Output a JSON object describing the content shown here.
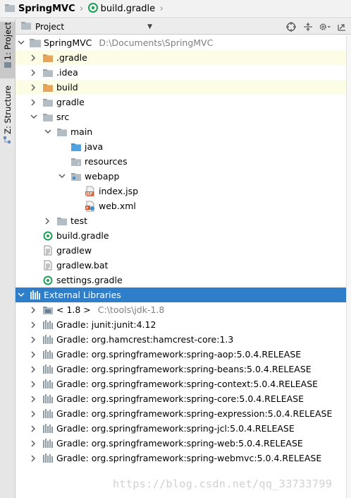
{
  "breadcrumb": {
    "project": "SpringMVC",
    "file": "build.gradle"
  },
  "toolstrip": {
    "tabs": [
      {
        "label": "1: Project",
        "active": true
      },
      {
        "label": "Z: Structure",
        "active": false
      }
    ]
  },
  "panel": {
    "title": "Project",
    "dropdown_icon": "triangle-down",
    "tools": [
      "target-icon",
      "collapse-all-icon",
      "gear-icon",
      "hide-icon"
    ]
  },
  "tree": {
    "root": {
      "label": "SpringMVC",
      "path": "D:\\Documents\\SpringMVC"
    },
    "items": [
      {
        "label": ".gradle",
        "icon": "folder-orange"
      },
      {
        "label": ".idea",
        "icon": "folder-gray"
      },
      {
        "label": "build",
        "icon": "folder-orange"
      },
      {
        "label": "gradle",
        "icon": "folder-gray"
      },
      {
        "label": "src",
        "icon": "folder-gray"
      },
      {
        "label": "main",
        "icon": "folder-gray"
      },
      {
        "label": "java",
        "icon": "folder-blue"
      },
      {
        "label": "resources",
        "icon": "folder-resources"
      },
      {
        "label": "webapp",
        "icon": "folder-web"
      },
      {
        "label": "index.jsp",
        "icon": "jsp-file"
      },
      {
        "label": "web.xml",
        "icon": "xml-file"
      },
      {
        "label": "test",
        "icon": "folder-gray"
      },
      {
        "label": "build.gradle",
        "icon": "gradle-file"
      },
      {
        "label": "gradlew",
        "icon": "text-file"
      },
      {
        "label": "gradlew.bat",
        "icon": "text-file"
      },
      {
        "label": "settings.gradle",
        "icon": "gradle-file"
      }
    ],
    "external": {
      "label": "External Libraries"
    },
    "libraries": [
      {
        "label": "< 1.8 >",
        "hint": "C:\\tools\\jdk-1.8"
      },
      {
        "label": "Gradle: junit:junit:4.12"
      },
      {
        "label": "Gradle: org.hamcrest:hamcrest-core:1.3"
      },
      {
        "label": "Gradle: org.springframework:spring-aop:5.0.4.RELEASE"
      },
      {
        "label": "Gradle: org.springframework:spring-beans:5.0.4.RELEASE"
      },
      {
        "label": "Gradle: org.springframework:spring-context:5.0.4.RELEASE"
      },
      {
        "label": "Gradle: org.springframework:spring-core:5.0.4.RELEASE"
      },
      {
        "label": "Gradle: org.springframework:spring-expression:5.0.4.RELEASE"
      },
      {
        "label": "Gradle: org.springframework:spring-jcl:5.0.4.RELEASE"
      },
      {
        "label": "Gradle: org.springframework:spring-web:5.0.4.RELEASE"
      },
      {
        "label": "Gradle: org.springframework:spring-webmvc:5.0.4.RELEASE"
      }
    ]
  },
  "watermark": "https://blog.csdn.net/qq_33733799",
  "colors": {
    "selection": "#2f7ec9",
    "highlight_row": "#fdfde6",
    "folder_orange": "#e8a55a",
    "folder_gray": "#a8b0b8",
    "folder_blue": "#4fa3e0"
  }
}
